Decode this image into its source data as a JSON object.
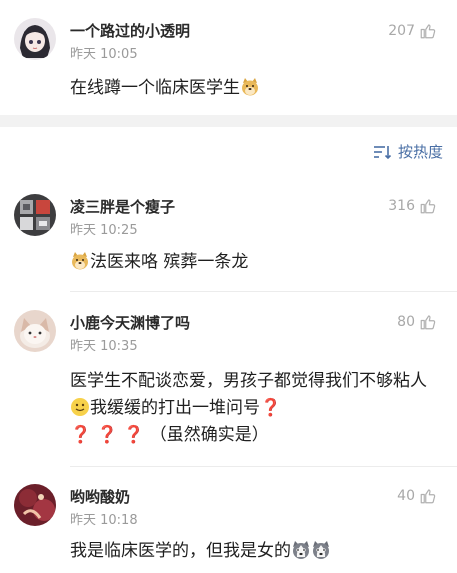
{
  "comments": [
    {
      "username": "一个路过的小透明",
      "time": "昨天 10:05",
      "likes": "207",
      "text": "在线蹲一个临床医学生"
    },
    {
      "username": "凌三胖是个瘦子",
      "time": "昨天 10:25",
      "likes": "316",
      "text": "法医来咯 殡葬一条龙"
    },
    {
      "username": "小鹿今天渊博了吗",
      "time": "昨天 10:35",
      "likes": "80",
      "text_part1": "医学生不配谈恋爱，男孩子都觉得我们不够粘人",
      "text_part2": "我缓缓的打出一堆问号",
      "question_marks": [
        "❓",
        "❓",
        "❓",
        "❓"
      ],
      "text_part3": "（虽然确实是）"
    },
    {
      "username": "哟哟酸奶",
      "time": "昨天 10:18",
      "likes": "40",
      "text": "我是临床医学的，但我是女的"
    }
  ],
  "sort": {
    "label": "按热度"
  }
}
